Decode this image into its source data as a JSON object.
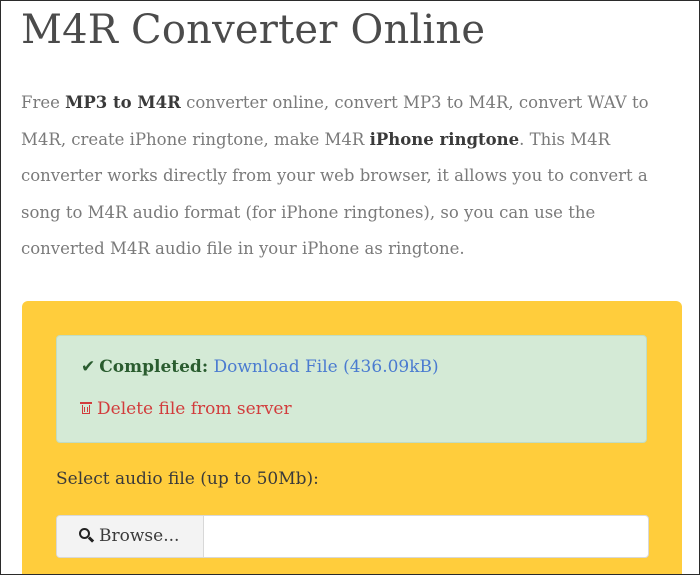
{
  "page": {
    "title": "M4R Converter Online"
  },
  "intro": {
    "t1": "Free ",
    "b1": "MP3 to M4R",
    "t2": " converter online, convert MP3 to M4R, convert WAV to M4R, create iPhone ringtone, make M4R ",
    "b2": "iPhone ringtone",
    "t3": ". This M4R converter works directly from your web browser, it allows you to convert a song to M4R audio format (for iPhone ringtones), so you can use the converted M4R audio file in your iPhone as ringtone."
  },
  "alert": {
    "icon": "check-icon",
    "status_label": "Completed:",
    "download_link": "Download File (436.09kB)",
    "delete_icon": "trash-icon",
    "delete_link": "Delete file from server",
    "bg_color": "#d4ead6"
  },
  "uploader": {
    "select_label": "Select audio file (up to 50Mb):",
    "browse_label": "Browse...",
    "browse_icon": "search-icon",
    "file_name_value": "",
    "panel_color": "#ffcd3c"
  }
}
